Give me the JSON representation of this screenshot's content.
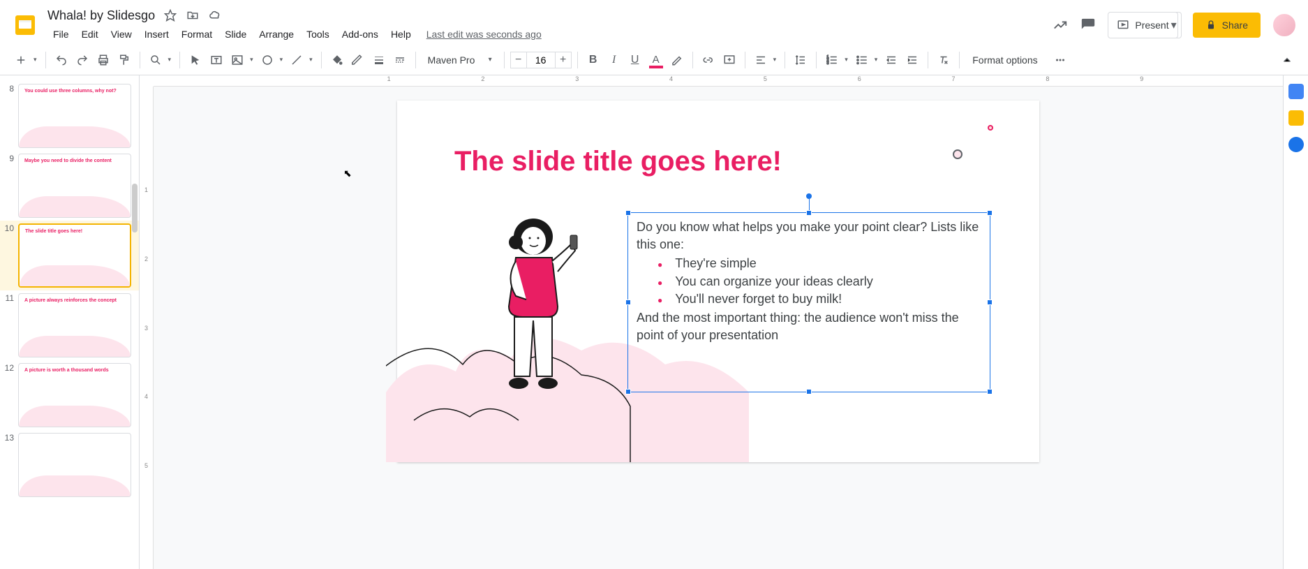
{
  "document": {
    "title": "Whala! by Slidesgo"
  },
  "menu": {
    "file": "File",
    "edit": "Edit",
    "view": "View",
    "insert": "Insert",
    "format": "Format",
    "slide": "Slide",
    "arrange": "Arrange",
    "tools": "Tools",
    "addons": "Add-ons",
    "help": "Help",
    "last_edit": "Last edit was seconds ago"
  },
  "header_buttons": {
    "present": "Present",
    "share": "Share"
  },
  "toolbar": {
    "font_name": "Maven Pro",
    "font_size": "16",
    "format_options": "Format options"
  },
  "ruler_h": [
    "1",
    "2",
    "3",
    "4",
    "5",
    "6",
    "7",
    "8",
    "9"
  ],
  "ruler_v": [
    "1",
    "2",
    "3",
    "4",
    "5"
  ],
  "thumbnails": [
    {
      "num": "8",
      "title": "You could use three columns, why not?"
    },
    {
      "num": "9",
      "title": "Maybe you need to divide the content"
    },
    {
      "num": "10",
      "title": "The slide title goes here!",
      "selected": true
    },
    {
      "num": "11",
      "title": "A picture always reinforces the concept"
    },
    {
      "num": "12",
      "title": "A picture is worth a thousand words"
    },
    {
      "num": "13",
      "title": ""
    }
  ],
  "slide": {
    "title": "The slide title goes here!",
    "body_intro": "Do you know what helps you make your point clear? Lists like this one:",
    "bullets": [
      "They're simple",
      "You can organize your ideas clearly",
      "You'll never forget to buy milk!"
    ],
    "body_outro": "And the most important thing: the audience won't miss the point of your presentation"
  },
  "colors": {
    "accent": "#e91e63",
    "share": "#fbbc04",
    "selection": "#1a73e8",
    "cloud": "#fde4ec"
  }
}
